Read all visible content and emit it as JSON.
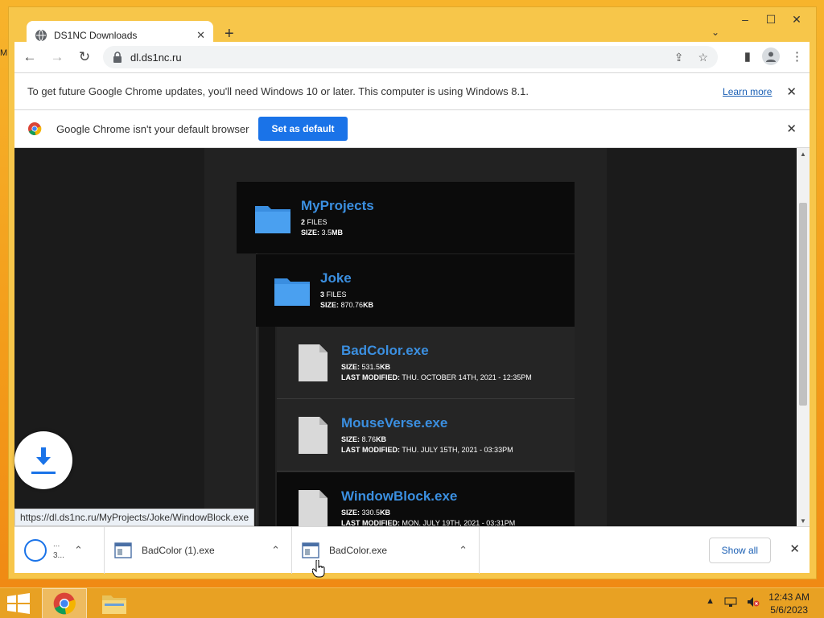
{
  "desktop": {
    "edge_text": "M"
  },
  "window": {
    "tab": {
      "title": "DS1NC Downloads",
      "close": "✕"
    },
    "new_tab": "+",
    "tab_search": "⌄",
    "controls": {
      "minimize": "–",
      "maximize": "☐",
      "close": "✕"
    }
  },
  "toolbar": {
    "back": "←",
    "forward": "→",
    "reload": "↻",
    "url": "dl.ds1nc.ru",
    "share": "⇪",
    "bookmark": "☆",
    "side_panel": "▮",
    "menu": "⋮"
  },
  "infobar_update": {
    "text": "To get future Google Chrome updates, you'll need Windows 10 or later. This computer is using Windows 8.1.",
    "link": "Learn more",
    "close": "✕"
  },
  "infobar_default": {
    "text": "Google Chrome isn't your default browser",
    "button": "Set as default",
    "close": "✕"
  },
  "listing": {
    "folder_root": {
      "name": "MyProjects",
      "files_count": "2",
      "files_label": "FILES",
      "size_label": "SIZE:",
      "size": "3.5",
      "size_unit": "MB"
    },
    "folder_sub": {
      "name": "Joke",
      "files_count": "3",
      "files_label": "FILES",
      "size_label": "SIZE:",
      "size": "870.76",
      "size_unit": "KB"
    },
    "files": [
      {
        "name": "BadColor.exe",
        "size_label": "SIZE:",
        "size": "531.5",
        "size_unit": "KB",
        "modified_label": "LAST MODIFIED:",
        "modified": "THU. OCTOBER 14TH, 2021 - 12:35PM"
      },
      {
        "name": "MouseVerse.exe",
        "size_label": "SIZE:",
        "size": "8.76",
        "size_unit": "KB",
        "modified_label": "LAST MODIFIED:",
        "modified": "THU. JULY 15TH, 2021 - 03:33PM"
      },
      {
        "name": "WindowBlock.exe",
        "size_label": "SIZE:",
        "size": "330.5",
        "size_unit": "KB",
        "modified_label": "LAST MODIFIED:",
        "modified": "MON. JULY 19TH, 2021 - 03:31PM"
      }
    ]
  },
  "status_url": "https://dl.ds1nc.ru/MyProjects/Joke/WindowBlock.exe",
  "downloads": {
    "items": [
      {
        "name": "...",
        "sub": "3..."
      },
      {
        "name": "BadColor (1).exe"
      },
      {
        "name": "BadColor.exe"
      }
    ],
    "chevron": "⌃",
    "show_all": "Show all",
    "close": "✕"
  },
  "taskbar": {
    "clock_time": "12:43 AM",
    "clock_date": "5/6/2023",
    "tray_arrow": "▲"
  },
  "colors": {
    "accent": "#1a73e8",
    "link": "#3b8fe0",
    "desktop": "#f5a623"
  }
}
